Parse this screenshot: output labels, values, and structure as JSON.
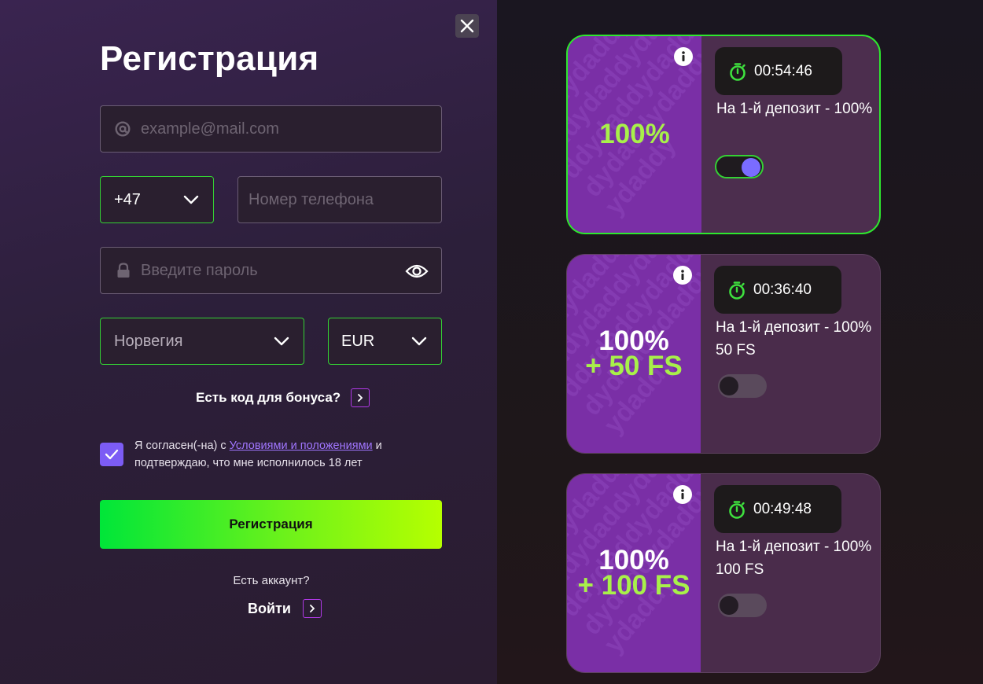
{
  "form": {
    "title": "Регистрация",
    "email_placeholder": "example@mail.com",
    "phone_code": "+47",
    "phone_placeholder": "Номер телефона",
    "password_placeholder": "Введите пароль",
    "country": "Норвегия",
    "currency": "EUR",
    "bonus_code_label": "Есть код для бонуса?",
    "terms_prefix": "Я согласен(-на) с ",
    "terms_link": "Условиями и положениями",
    "terms_suffix": " и подтверждаю, что мне исполнилось 18 лет",
    "terms_checked": true,
    "submit_label": "Регистрация",
    "have_account": "Есть аккаунт?",
    "login_label": "Войти"
  },
  "bonuses": [
    {
      "promo_line1": "100%",
      "promo_line2": "",
      "timer": "00:54:46",
      "label_line1": "На 1-й депозит - 100%",
      "label_line2": "",
      "selected": true
    },
    {
      "promo_line1": "100%",
      "promo_line2": "+ 50 FS",
      "timer": "00:36:40",
      "label_line1": "На 1-й депозит - 100%",
      "label_line2": "50 FS",
      "selected": false
    },
    {
      "promo_line1": "100%",
      "promo_line2": "+ 100 FS",
      "timer": "00:49:48",
      "label_line1": "На 1-й депозит - 100%",
      "label_line2": "100 FS",
      "selected": false
    }
  ],
  "colors": {
    "accent_green": "#34d134",
    "accent_purple": "#7c5cf5",
    "card_promo_bg": "#7a2fa6",
    "promo_green": "#a8f04a"
  }
}
